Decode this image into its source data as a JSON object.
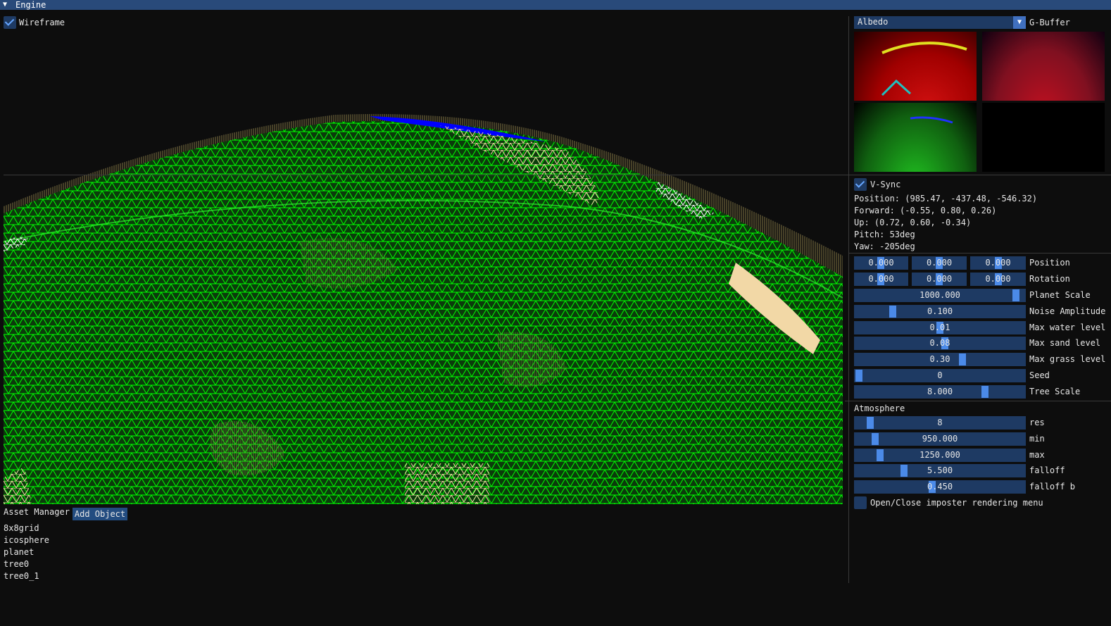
{
  "window": {
    "title": "Engine",
    "collapse_icon": "triangle-down-icon"
  },
  "viewport": {
    "wireframe_label": "Wireframe",
    "wireframe_checked": true,
    "colors": {
      "grass": "#00ff00",
      "sand": "#f2d8a6",
      "water": "#0000ff",
      "snow": "#ffffff",
      "trees": "#8a7d4a"
    }
  },
  "gbuffer": {
    "selected": "Albedo",
    "label": "G-Buffer"
  },
  "vsync": {
    "label": "V-Sync",
    "checked": true
  },
  "camera": {
    "position": "Position: (985.47, -437.48, -546.32)",
    "forward": "Forward: (-0.55, 0.80, 0.26)",
    "up": "Up: (0.72, 0.60, -0.34)",
    "pitch": "Pitch: 53deg",
    "yaw": "Yaw: -205deg"
  },
  "transform": {
    "position": {
      "label": "Position",
      "values": [
        "0.000",
        "0.000",
        "0.000"
      ]
    },
    "rotation": {
      "label": "Rotation",
      "values": [
        "0.000",
        "0.000",
        "0.000"
      ]
    }
  },
  "planet": [
    {
      "label": "Planet Scale",
      "value": "1000.000",
      "fraction": 0.97
    },
    {
      "label": "Noise Amplitude",
      "value": "0.100",
      "fraction": 0.21
    },
    {
      "label": "Max water level",
      "value": "0.01",
      "fraction": 0.5
    },
    {
      "label": "Max sand level",
      "value": "0.08",
      "fraction": 0.53
    },
    {
      "label": "Max grass level",
      "value": "0.30",
      "fraction": 0.64
    },
    {
      "label": "Seed",
      "value": "0",
      "fraction": 0.0
    },
    {
      "label": "Tree Scale",
      "value": "8.000",
      "fraction": 0.78
    }
  ],
  "atmosphere": {
    "header": "Atmosphere",
    "fields": [
      {
        "label": "res",
        "value": "8",
        "fraction": 0.07
      },
      {
        "label": "min",
        "value": "950.000",
        "fraction": 0.1
      },
      {
        "label": "max",
        "value": "1250.000",
        "fraction": 0.13
      },
      {
        "label": "falloff",
        "value": "5.500",
        "fraction": 0.28
      },
      {
        "label": "falloff b",
        "value": "0.450",
        "fraction": 0.45
      }
    ]
  },
  "imposter": {
    "label": "Open/Close imposter rendering menu",
    "checked": false
  },
  "assets": {
    "title": "Asset Manager",
    "add_label": "Add Object",
    "items": [
      "8x8grid",
      "icosphere",
      "planet",
      "tree0",
      "tree0_1"
    ]
  }
}
